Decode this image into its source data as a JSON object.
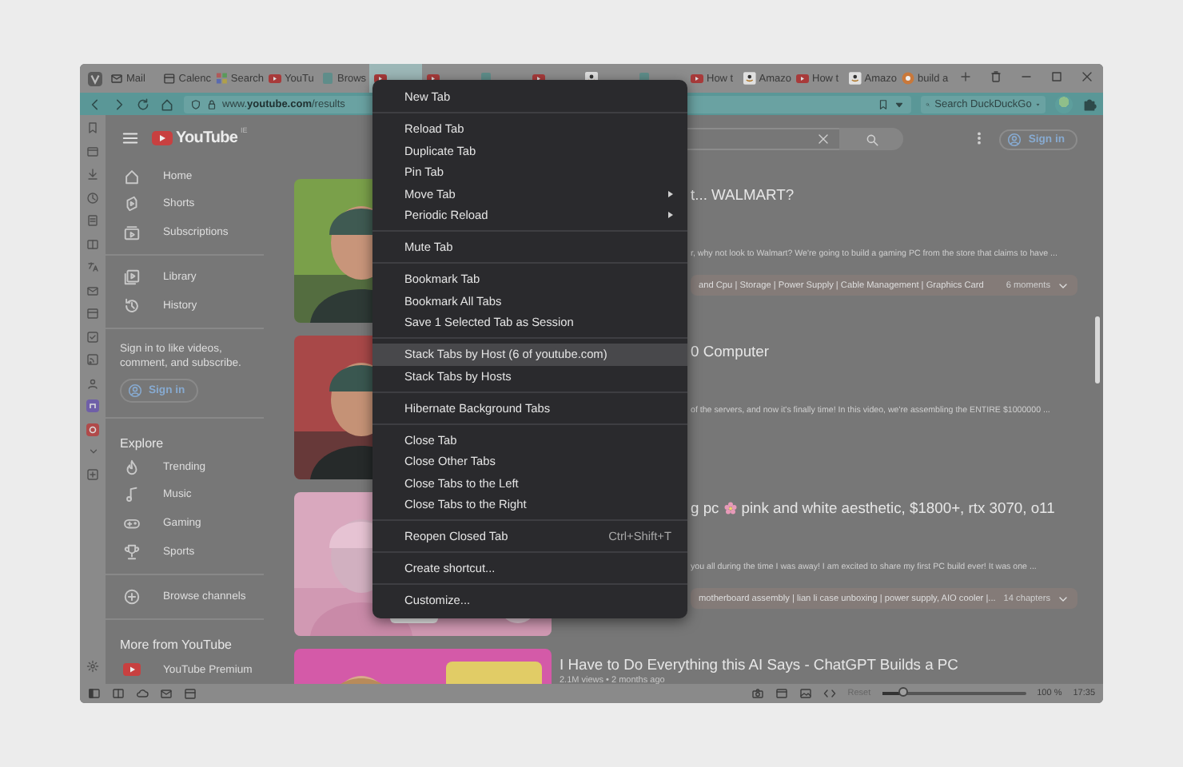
{
  "tabs": [
    {
      "title": "Mail",
      "selected": false
    },
    {
      "title": "Calenc",
      "selected": false
    },
    {
      "title": "Search",
      "selected": false
    },
    {
      "title": "YouTu",
      "selected": false
    },
    {
      "title": "Brows",
      "selected": false
    },
    {
      "selected": true
    },
    {
      "selected": false
    },
    {
      "selected": false
    },
    {
      "selected": false
    },
    {
      "selected": false
    },
    {
      "selected": false
    },
    {
      "title": "How t",
      "selected": false
    },
    {
      "title": "Amazo",
      "selected": false
    },
    {
      "title": "How t",
      "selected": false
    },
    {
      "title": "Amazo",
      "selected": false
    },
    {
      "title": "build a",
      "selected": false
    }
  ],
  "address_bar": {
    "url": "www.**youtube.com**/results",
    "search_placeholder": "Search DuckDuckGo"
  },
  "youtube": {
    "logo": {
      "text": "YouTube",
      "region": "IE"
    },
    "sign_in": "Sign in"
  },
  "sidebar": {
    "main": [
      "Home",
      "Shorts",
      "Subscriptions"
    ],
    "library": [
      "Library",
      "History"
    ],
    "signin_prompt": "Sign in to like videos, comment, and subscribe.",
    "signin_button": "Sign in",
    "explore_heading": "Explore",
    "explore": [
      "Trending",
      "Music",
      "Gaming",
      "Sports"
    ],
    "browse": "Browse channels",
    "more_heading": "More from YouTube",
    "more": [
      "YouTube Premium"
    ]
  },
  "videos": [
    {
      "covered": true,
      "title": "t... WALMART?",
      "description": "r, why not look to Walmart? We're going to build a gaming PC from the store that claims to have ...",
      "chapters": "and Cpu | Storage | Power Supply | Cable Management | Graphics Card",
      "chapter_count": "6 moments"
    },
    {
      "covered": true,
      "title": "0 Computer",
      "description": "of the servers, and now it's finally time! In this video, we're assembling the ENTIRE $1000000 ..."
    },
    {
      "covered": true,
      "title": "g pc",
      "title_icon": true,
      "title_end": "pink and white aesthetic, $1800+, rtx 3070, o11",
      "description": "you all during the time I was away! I am excited to share my first PC build ever! It was one ...",
      "chapters": "motherboard assembly | lian li case unboxing | power supply, AIO cooler |...",
      "chapter_count": "14 chapters"
    },
    {
      "covered": false,
      "title": "I Have to Do Everything this AI Says - ChatGPT Builds a PC",
      "meta": "2.1M views • 2 months ago"
    }
  ],
  "context_menu": [
    {
      "kind": "item",
      "label": "New Tab",
      "selected": false
    },
    {
      "kind": "separator"
    },
    {
      "kind": "item",
      "label": "Reload Tab",
      "selected": false
    },
    {
      "kind": "item",
      "label": "Duplicate Tab",
      "selected": false
    },
    {
      "kind": "item",
      "label": "Pin Tab",
      "selected": false
    },
    {
      "kind": "item",
      "label": "Move Tab",
      "submenu": true,
      "selected": false
    },
    {
      "kind": "item",
      "label": "Periodic Reload",
      "submenu": true,
      "selected": false
    },
    {
      "kind": "separator"
    },
    {
      "kind": "item",
      "label": "Mute Tab",
      "selected": false
    },
    {
      "kind": "separator"
    },
    {
      "kind": "item",
      "label": "Bookmark Tab",
      "selected": false
    },
    {
      "kind": "item",
      "label": "Bookmark All Tabs",
      "selected": false
    },
    {
      "kind": "item",
      "label": "Save 1 Selected Tab as Session",
      "selected": false
    },
    {
      "kind": "separator"
    },
    {
      "kind": "item",
      "label": "Stack Tabs by Host (6 of youtube.com)",
      "selected": true
    },
    {
      "kind": "item",
      "label": "Stack Tabs by Hosts",
      "selected": false
    },
    {
      "kind": "separator"
    },
    {
      "kind": "item",
      "label": "Hibernate Background Tabs",
      "selected": false
    },
    {
      "kind": "separator"
    },
    {
      "kind": "item",
      "label": "Close Tab",
      "selected": false
    },
    {
      "kind": "item",
      "label": "Close Other Tabs",
      "selected": false
    },
    {
      "kind": "item",
      "label": "Close Tabs to the Left",
      "selected": false
    },
    {
      "kind": "item",
      "label": "Close Tabs to the Right",
      "selected": false
    },
    {
      "kind": "separator"
    },
    {
      "kind": "item",
      "label": "Reopen Closed Tab",
      "shortcut": "Ctrl+Shift+T",
      "selected": false
    },
    {
      "kind": "separator"
    },
    {
      "kind": "item",
      "label": "Create shortcut...",
      "selected": false
    },
    {
      "kind": "separator"
    },
    {
      "kind": "item",
      "label": "Customize...",
      "selected": false
    }
  ],
  "status_bar": {
    "reset": "Reset",
    "zoom": {
      "level": 0.15
    },
    "zoom_reading": "100 %",
    "clock": "17:35"
  }
}
